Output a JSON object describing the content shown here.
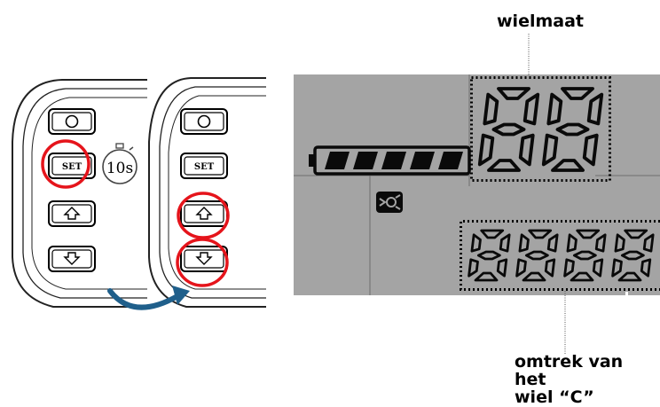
{
  "annotations": {
    "wheel_size_label": "wielmaat",
    "circumference_label_line1": "omtrek van het",
    "circumference_label_line2": "wiel “C”"
  },
  "controller_left": {
    "buttons": [
      "power",
      "SET",
      "up",
      "down"
    ],
    "set_label": "SET",
    "highlighted": [
      "SET"
    ]
  },
  "timer": {
    "text": "10s",
    "icon": "stopwatch-icon"
  },
  "controller_right": {
    "buttons": [
      "power",
      "SET",
      "up",
      "down"
    ],
    "set_label": "SET",
    "highlighted": [
      "up",
      "down"
    ]
  },
  "transition_arrow": {
    "icon": "curved-arrow-icon",
    "color": "#1f5f8b"
  },
  "lcd": {
    "background_color": "#a4a4a4",
    "battery_segments": 5,
    "wheel_size_digits": "88",
    "circumference_digits": "8888",
    "status_icon": "bicycle-sensor-icon"
  },
  "colors": {
    "highlight": "#e5141b",
    "lcd_segment": "#0a0a0a"
  }
}
